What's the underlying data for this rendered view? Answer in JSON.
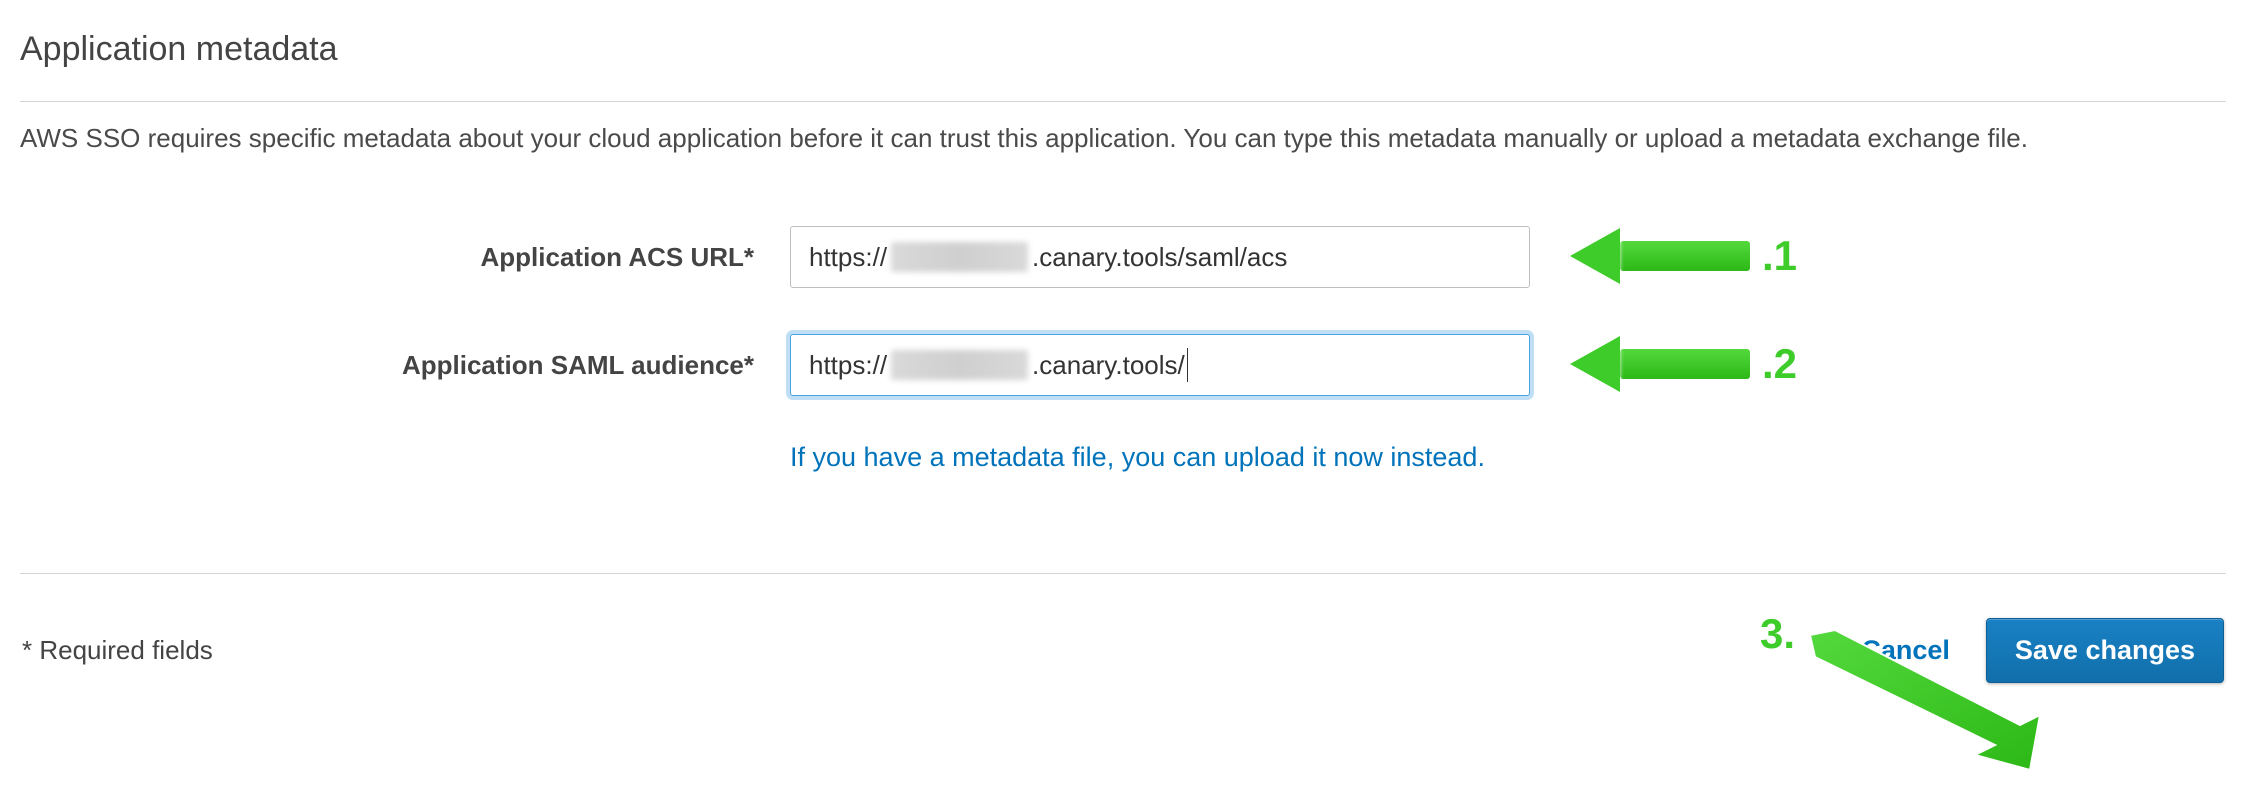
{
  "section": {
    "title": "Application metadata",
    "description": "AWS SSO requires specific metadata about your cloud application before it can trust this application. You can type this metadata manually or upload a metadata exchange file."
  },
  "form": {
    "acs": {
      "label": "Application ACS URL*",
      "value_prefix": "https://",
      "value_suffix": ".canary.tools/saml/acs"
    },
    "audience": {
      "label": "Application SAML audience*",
      "value_prefix": "https://",
      "value_suffix": ".canary.tools/"
    },
    "upload_link": "If you have a metadata file, you can upload it now instead."
  },
  "footer": {
    "required_note": "* Required fields",
    "cancel": "Cancel",
    "save": "Save changes"
  },
  "annotations": {
    "num1": ".1",
    "num2": ".2",
    "num3": "3."
  }
}
